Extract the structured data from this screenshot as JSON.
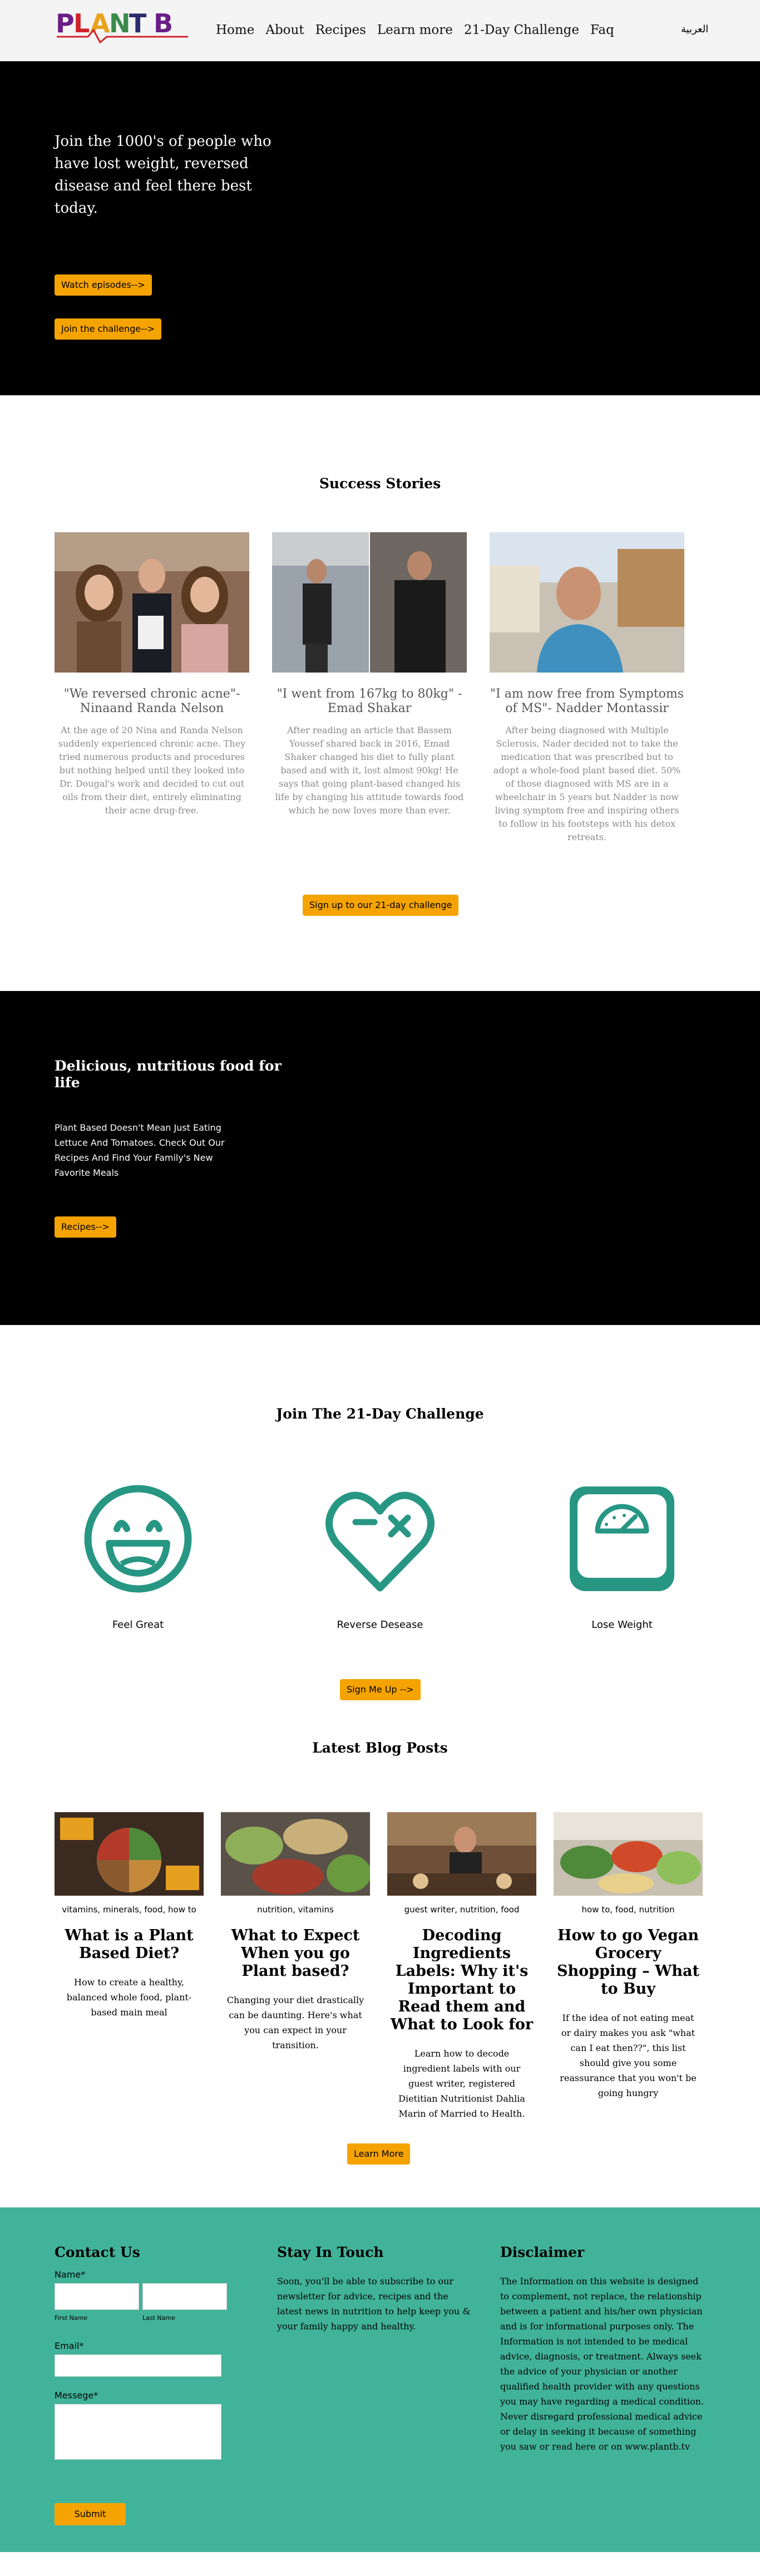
{
  "header": {
    "logo_text": "PLANT B",
    "nav": [
      "Home",
      "About",
      "Recipes",
      "Learn more",
      "21-Day Challenge",
      "Faq"
    ],
    "lang": "العربية"
  },
  "hero": {
    "text": "Join the 1000's of people who have lost weight, reversed disease and feel there best today.",
    "btn_watch": "Watch episodes-->",
    "btn_join": "Join the challenge-->"
  },
  "success": {
    "title": "Success Stories",
    "stories": [
      {
        "title": "\"We reversed chronic acne\"- Ninaand Randa Nelson",
        "text": "At the age of 20 Nina and Randa Nelson suddenly experienced chronic acne. They tried numerous products and procedures but nothing helped until they looked into Dr. Dougal's work and decided to cut out oils from their diet, entirely eliminating their acne drug-free."
      },
      {
        "title": "\"I went from 167kg to 80kg\" - Emad Shakar",
        "text": "After reading an article that Bassem Youssef shared back in 2016, Emad Shaker changed his diet to fully plant based and with it, lost almost 90kg! He says that going plant-based changed his life by changing his attitude towards food which he now loves more than ever."
      },
      {
        "title": "\"I am now free from Symptoms of MS\"- Nadder Montassir",
        "text": "After being diagnosed with Multiple Sclerosis, Nader decided not to take the medication that was prescribed but to adopt a whole-food plant based diet. 50% of those diagnosed with MS are in a wheelchair in 5 years but Nadder is now living symptom free and inspiring others to follow in his footsteps with his detox retreats."
      }
    ],
    "btn": "Sign up to our 21-day challenge"
  },
  "food": {
    "title": "Delicious, nutritious food for life",
    "text": "Plant Based Doesn't Mean Just Eating Lettuce And Tomatoes. Check Out Our Recipes And Find Your Family's New Favorite Meals",
    "btn": "Recipes-->"
  },
  "challenge": {
    "title": "Join The 21-Day Challenge",
    "items": [
      {
        "label": "Feel Great",
        "icon": "smile-icon"
      },
      {
        "label": "Reverse Desease",
        "icon": "heart-icon"
      },
      {
        "label": "Lose Weight",
        "icon": "scale-icon"
      }
    ],
    "btn": "Sign Me Up -->",
    "accent": "#279784"
  },
  "blog": {
    "title": "Latest Blog Posts",
    "posts": [
      {
        "tags": "vitamins, minerals, food, how to",
        "title": "What is a Plant Based Diet?",
        "text": "How to create a healthy, balanced whole food, plant-based main meal"
      },
      {
        "tags": "nutrition, vitamins",
        "title": "What to Expect When you go Plant based?",
        "text": "Changing your diet drastically can be daunting. Here's what you can expect in your transition."
      },
      {
        "tags": "guest writer, nutrition, food",
        "title": "Decoding Ingredients Labels: Why it's Important to Read them and What to Look for",
        "text": "Learn how to decode ingredient labels with our guest writer, registered Dietitian Nutritionist Dahlia Marin of Married to Health."
      },
      {
        "tags": "how to, food, nutrition",
        "title": "How to go Vegan Grocery Shopping – What to Buy",
        "text": "If the idea of not eating meat or dairy makes you ask \"what can I eat then??\", this list should give you some reassurance that you won't be going hungry"
      }
    ],
    "btn": "Learn More"
  },
  "footer": {
    "contact_title": "Contact Us",
    "name_label": "Name*",
    "first_name": "First Name",
    "last_name": "Last Name",
    "email_label": "Email*",
    "message_label": "Messege*",
    "submit": "Submit",
    "stay_title": "Stay In Touch",
    "stay_text": "Soon, you'll be able to subscribe to our newsletter for advice, recipes and the latest news in nutrition to help keep you & your family happy and healthy.",
    "disclaimer_title": "Disclaimer",
    "disclaimer_text": "The Information on this website is designed to complement, not replace, the relationship between a patient and his/her own physician and is for informational purposes only. The Information is not intended to be medical advice, diagnosis, or treatment. Always seek the advice of your physician or another qualified health provider with any questions you may have regarding a medical condition. Never disregard professional medical advice or delay in seeking it because of something you saw or read here or on www.plantb.tv",
    "bg": "#41b39a"
  }
}
